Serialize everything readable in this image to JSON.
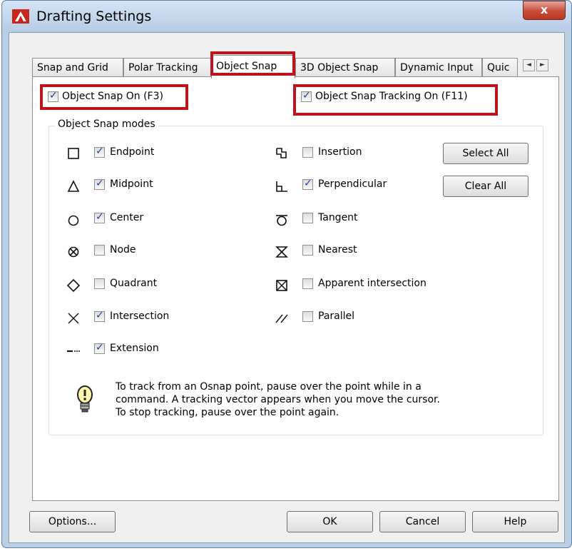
{
  "window": {
    "title": "Drafting Settings",
    "close_label": "x"
  },
  "tabs": [
    {
      "label": "Snap and Grid"
    },
    {
      "label": "Polar Tracking"
    },
    {
      "label": "Object Snap"
    },
    {
      "label": "3D Object Snap"
    },
    {
      "label": "Dynamic Input"
    },
    {
      "label": "Quic"
    }
  ],
  "tab_scroll": {
    "left": "◄",
    "right": "►"
  },
  "object_snap_on": {
    "label": "Object Snap On (F3)",
    "checked": true
  },
  "object_snap_tracking_on": {
    "label": "Object Snap Tracking On (F11)",
    "checked": true
  },
  "group": {
    "title": "Object Snap modes"
  },
  "modes_left": [
    {
      "label": "Endpoint",
      "checked": true,
      "symbol": "endpoint-icon"
    },
    {
      "label": "Midpoint",
      "checked": true,
      "symbol": "midpoint-icon"
    },
    {
      "label": "Center",
      "checked": true,
      "symbol": "center-icon"
    },
    {
      "label": "Node",
      "checked": false,
      "symbol": "node-icon"
    },
    {
      "label": "Quadrant",
      "checked": false,
      "symbol": "quadrant-icon"
    },
    {
      "label": "Intersection",
      "checked": true,
      "symbol": "intersection-icon"
    },
    {
      "label": "Extension",
      "checked": true,
      "symbol": "extension-icon"
    }
  ],
  "modes_right": [
    {
      "label": "Insertion",
      "checked": false,
      "symbol": "insertion-icon"
    },
    {
      "label": "Perpendicular",
      "checked": true,
      "symbol": "perpendicular-icon"
    },
    {
      "label": "Tangent",
      "checked": false,
      "symbol": "tangent-icon"
    },
    {
      "label": "Nearest",
      "checked": false,
      "symbol": "nearest-icon"
    },
    {
      "label": "Apparent intersection",
      "checked": false,
      "symbol": "apparent-intersection-icon"
    },
    {
      "label": "Parallel",
      "checked": false,
      "symbol": "parallel-icon"
    }
  ],
  "buttons": {
    "select_all": "Select All",
    "clear_all": "Clear All",
    "options": "Options...",
    "ok": "OK",
    "cancel": "Cancel",
    "help": "Help"
  },
  "hint": {
    "line1": "To track from an Osnap point, pause over the point while in a",
    "line2": "command.  A tracking vector appears when you move the cursor.",
    "line3": "To stop tracking, pause over the point again."
  },
  "colors": {
    "highlight": "#c0141c",
    "check": "#1f3f9d",
    "title_bar": "#b9cfe6"
  }
}
